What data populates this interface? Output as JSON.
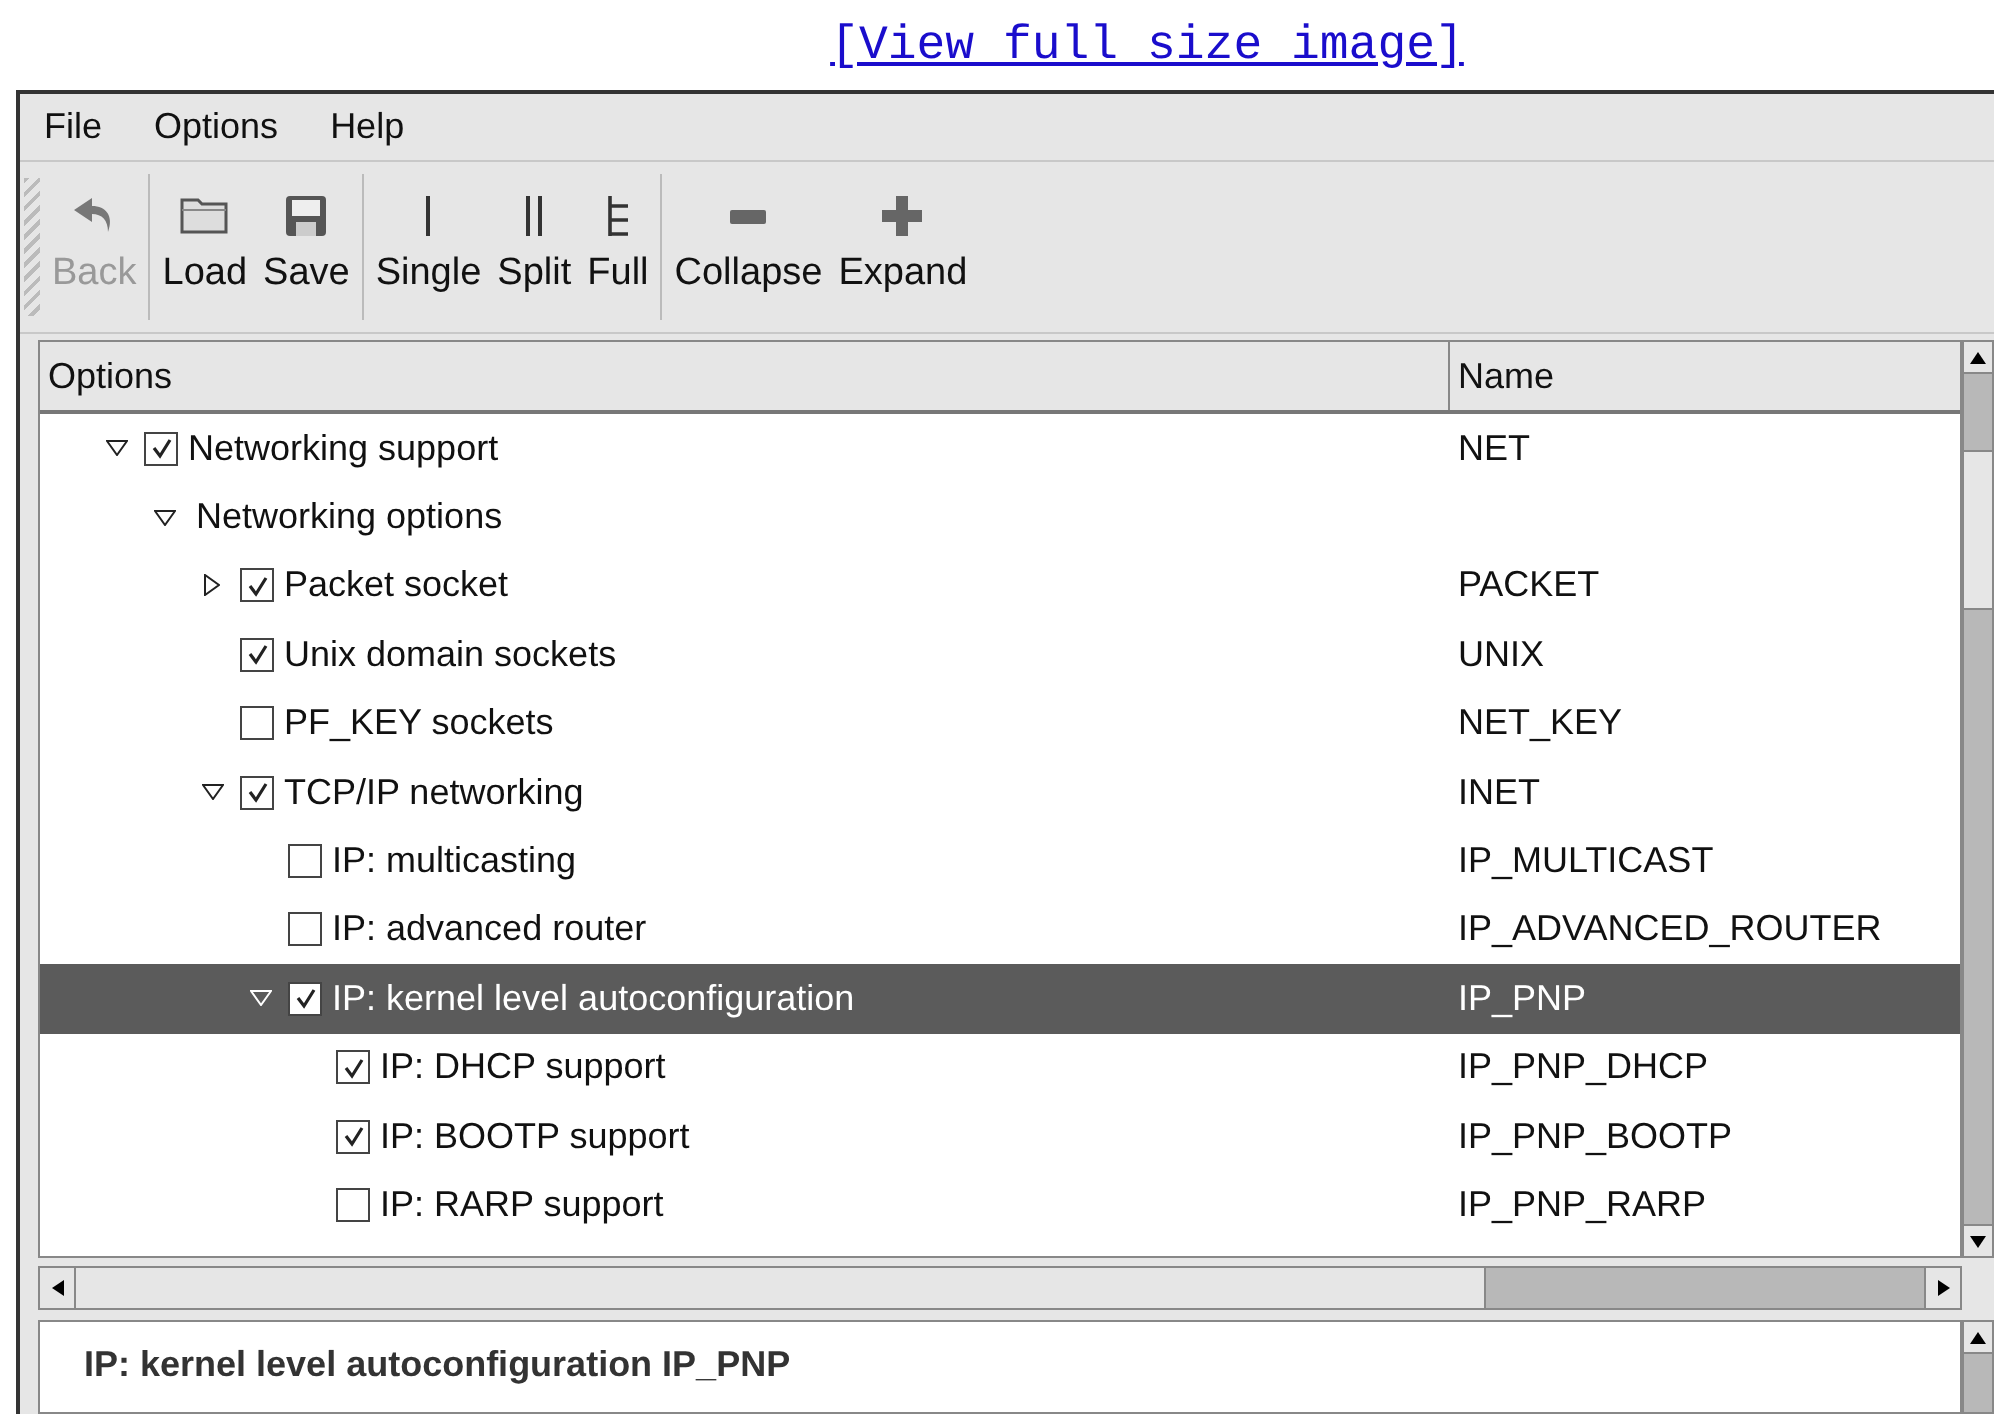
{
  "link": "[View full size image]",
  "menu": [
    "File",
    "Options",
    "Help"
  ],
  "toolbar": [
    [
      {
        "label": "Back",
        "disabled": true
      }
    ],
    [
      {
        "label": "Load",
        "disabled": false
      },
      {
        "label": "Save",
        "disabled": false
      }
    ],
    [
      {
        "label": "Single",
        "disabled": false
      },
      {
        "label": "Split",
        "disabled": false
      },
      {
        "label": "Full",
        "disabled": false
      }
    ],
    [
      {
        "label": "Collapse",
        "disabled": false
      },
      {
        "label": "Expand",
        "disabled": false
      }
    ]
  ],
  "table": {
    "columns": [
      "Options",
      "Name"
    ],
    "tree": [
      {
        "label": "Networking support",
        "name": "NET",
        "checked": true,
        "expanded": true,
        "selected": false,
        "children": [
          {
            "label": "Networking options",
            "expanded": true,
            "selected": false,
            "children": [
              {
                "label": "Packet socket",
                "name": "PACKET",
                "checked": true,
                "expanded": false,
                "selected": false
              },
              {
                "label": "Unix domain sockets",
                "name": "UNIX",
                "checked": true,
                "selected": false
              },
              {
                "label": "PF_KEY sockets",
                "name": "NET_KEY",
                "checked": false,
                "selected": false
              },
              {
                "label": "TCP/IP networking",
                "name": "INET",
                "checked": true,
                "expanded": true,
                "selected": false,
                "children": [
                  {
                    "label": "IP: multicasting",
                    "name": "IP_MULTICAST",
                    "checked": false,
                    "selected": false
                  },
                  {
                    "label": "IP: advanced router",
                    "name": "IP_ADVANCED_ROUTER",
                    "checked": false,
                    "selected": false
                  },
                  {
                    "label": "IP: kernel level autoconfiguration",
                    "name": "IP_PNP",
                    "checked": true,
                    "expanded": true,
                    "selected": true,
                    "children": [
                      {
                        "label": "IP: DHCP support",
                        "name": "IP_PNP_DHCP",
                        "checked": true,
                        "selected": false
                      },
                      {
                        "label": "IP: BOOTP support",
                        "name": "IP_PNP_BOOTP",
                        "checked": true,
                        "selected": false
                      },
                      {
                        "label": "IP: RARP support",
                        "name": "IP_PNP_RARP",
                        "checked": false,
                        "selected": false
                      }
                    ]
                  }
                ]
              }
            ]
          }
        ]
      }
    ]
  },
  "help_text": "IP: kernel level autoconfiguration IP_PNP"
}
